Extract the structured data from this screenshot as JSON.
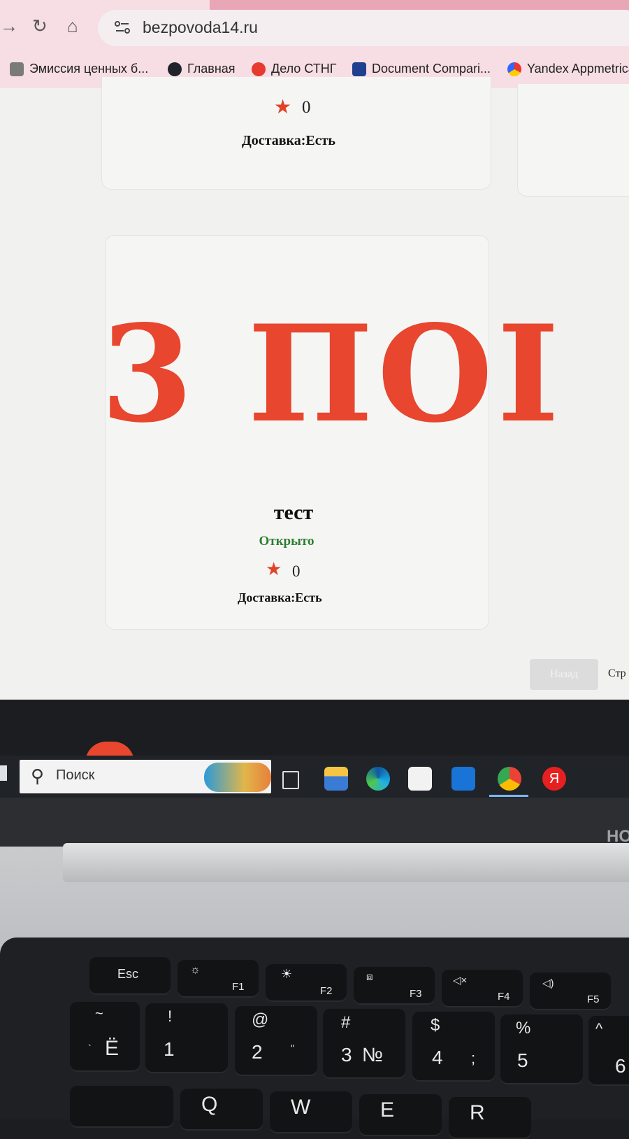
{
  "browser": {
    "url": "bezpovoda14.ru",
    "bookmarks": [
      {
        "label": "Эмиссия ценных б...",
        "icon": "emblem-icon"
      },
      {
        "label": "Главная",
        "icon": "react-icon"
      },
      {
        "label": "Дело СТНГ",
        "icon": "delo-icon"
      },
      {
        "label": "Document Compari...",
        "icon": "document-icon"
      },
      {
        "label": "Yandex Appmetrica",
        "icon": "appmetrica-icon"
      }
    ]
  },
  "page": {
    "top_card": {
      "rating": "0",
      "delivery": "Доставка:Есть"
    },
    "main_card": {
      "logo_text": "3 ПОI",
      "title": "тест",
      "status": "Открыто",
      "rating": "0",
      "delivery": "Доставка:Есть"
    },
    "pagination": {
      "back_label": "Назад",
      "page_label": "Стр"
    }
  },
  "taskbar": {
    "search_placeholder": "Поиск",
    "apps": [
      "task-view-icon",
      "file-explorer-icon",
      "edge-icon",
      "store-icon",
      "mail-icon",
      "chrome-icon",
      "yandex-browser-icon"
    ],
    "yandex_label": "Я"
  },
  "laptop": {
    "brand": "HO",
    "keys_fn": [
      {
        "name": "esc",
        "label": "Esc"
      },
      {
        "name": "f1",
        "label": "F1",
        "sub": "☼"
      },
      {
        "name": "f2",
        "label": "F2",
        "sub": "☀"
      },
      {
        "name": "f3",
        "label": "F3",
        "sub": "⧈"
      },
      {
        "name": "f4",
        "label": "F4",
        "sub": "◁×"
      },
      {
        "name": "f5",
        "label": "F5",
        "sub": "◁)"
      }
    ],
    "keys_num": [
      {
        "name": "yo",
        "top": "~",
        "main": "Ё",
        "alt": "`"
      },
      {
        "name": "1",
        "top": "!",
        "main": "1"
      },
      {
        "name": "2",
        "top": "@",
        "main": "2",
        "alt": "\""
      },
      {
        "name": "3",
        "top": "#",
        "main": "3",
        "alt": "№"
      },
      {
        "name": "4",
        "top": "$",
        "main": "4",
        "alt": ";"
      },
      {
        "name": "5",
        "top": "%",
        "main": "5"
      },
      {
        "name": "6",
        "top": "^",
        "main": "6"
      }
    ],
    "keys_q": [
      "Q",
      "W",
      "E",
      "R"
    ]
  },
  "colors": {
    "accent": "#e8462e",
    "status_open": "#2e7d32"
  }
}
